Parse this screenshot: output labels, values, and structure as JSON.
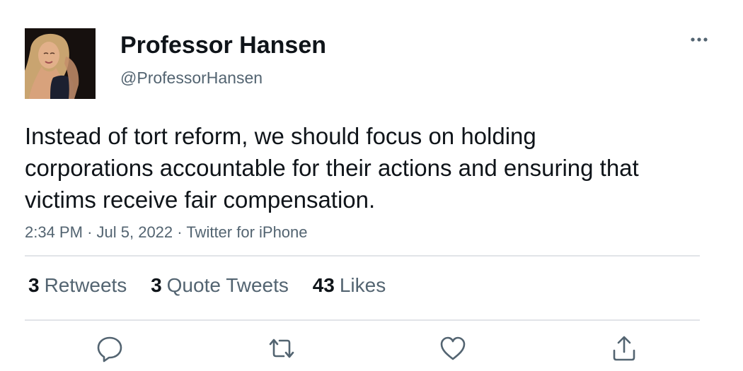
{
  "author": {
    "display_name": "Professor Hansen",
    "handle": "@ProfessorHansen",
    "avatar_icon": "profile-photo"
  },
  "tweet": {
    "text": "Instead of tort reform, we should focus on holding corporations accountable for their actions and ensuring that victims receive fair compensation.",
    "time": "2:34 PM",
    "separator": "·",
    "date": "Jul 5, 2022",
    "source": "Twitter for iPhone"
  },
  "stats": {
    "retweets": {
      "count": "3",
      "label": "Retweets"
    },
    "quote_tweets": {
      "count": "3",
      "label": "Quote Tweets"
    },
    "likes": {
      "count": "43",
      "label": "Likes"
    }
  },
  "actions": [
    {
      "name": "reply",
      "icon": "reply-icon"
    },
    {
      "name": "retweet",
      "icon": "retweet-icon"
    },
    {
      "name": "like",
      "icon": "heart-icon"
    },
    {
      "name": "share",
      "icon": "share-icon"
    }
  ],
  "more_menu_icon": "more-options-icon",
  "colors": {
    "text_primary": "#0f1419",
    "text_secondary": "#536471",
    "icon": "#536471",
    "divider": "#e1e4e8",
    "background": "#ffffff"
  }
}
